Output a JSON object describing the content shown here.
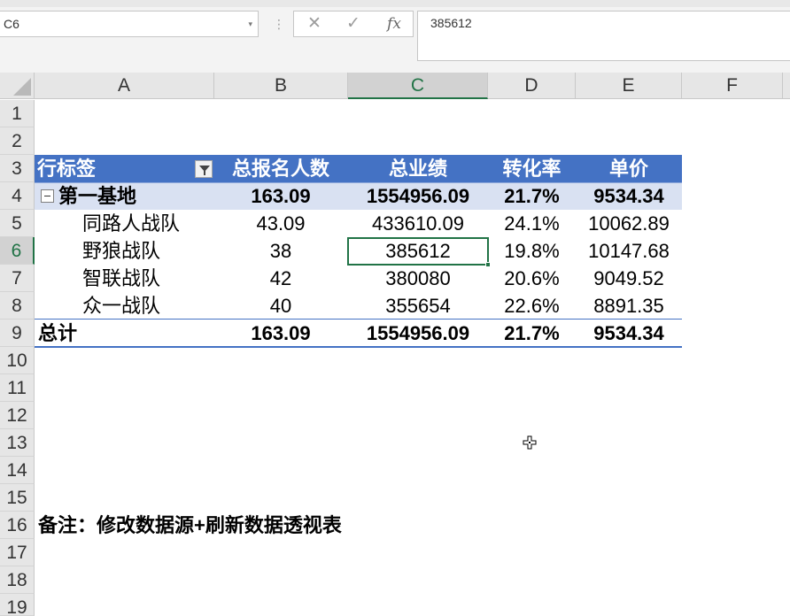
{
  "formula_bar": {
    "name_box": "C6",
    "name_box_arrow": "▾",
    "dots": "⋮",
    "cancel_glyph": "✕",
    "enter_glyph": "✓",
    "fx_glyph": "fx",
    "formula_value": "385612"
  },
  "columns": [
    "A",
    "B",
    "C",
    "D",
    "E",
    "F"
  ],
  "active_column": "C",
  "rows": [
    "1",
    "2",
    "3",
    "4",
    "5",
    "6",
    "7",
    "8",
    "9",
    "10",
    "11",
    "12",
    "13",
    "14",
    "15",
    "16",
    "17",
    "18",
    "19"
  ],
  "active_row": "6",
  "pivot": {
    "headers": [
      "行标签",
      "总报名人数",
      "总业绩",
      "转化率",
      "单价"
    ],
    "group": {
      "label": "第一基地",
      "values": [
        "163.09",
        "1554956.09",
        "21.7%",
        "9534.34"
      ]
    },
    "items": [
      {
        "label": "同路人战队",
        "values": [
          "43.09",
          "433610.09",
          "24.1%",
          "10062.89"
        ]
      },
      {
        "label": "野狼战队",
        "values": [
          "38",
          "385612",
          "19.8%",
          "10147.68"
        ]
      },
      {
        "label": "智联战队",
        "values": [
          "42",
          "380080",
          "20.6%",
          "9049.52"
        ]
      },
      {
        "label": "众一战队",
        "values": [
          "40",
          "355654",
          "22.6%",
          "8891.35"
        ]
      }
    ],
    "total": {
      "label": "总计",
      "values": [
        "163.09",
        "1554956.09",
        "21.7%",
        "9534.34"
      ]
    }
  },
  "note": "备注：修改数据源+刷新数据透视表",
  "colors": {
    "pivot_header": "#4472c4",
    "pivot_subtotal": "#d9e1f2",
    "selection": "#217346"
  },
  "icons": {
    "filter": "filter-dropdown-icon",
    "collapse": "collapse-minus-icon",
    "cursor": "move-cursor-icon"
  }
}
